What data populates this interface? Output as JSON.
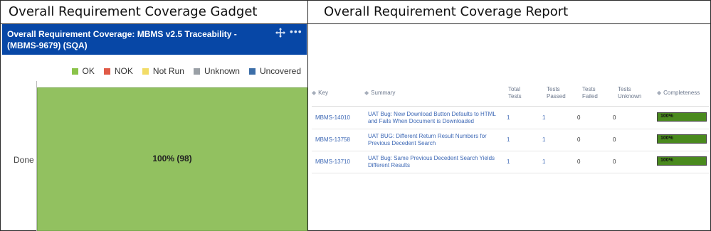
{
  "panels": {
    "left_title": "Overall Requirement Coverage Gadget",
    "right_title": "Overall Requirement Coverage Report"
  },
  "gadget": {
    "title": "Overall Requirement Coverage: MBMS v2.5 Traceability - (MBMS-9679) (SQA)",
    "header_color": "#0747a6",
    "icons": [
      "move-icon",
      "more-icon"
    ],
    "more_glyph": "•••",
    "legend": [
      {
        "label": "OK",
        "color": "#8bc34a"
      },
      {
        "label": "NOK",
        "color": "#e05a47"
      },
      {
        "label": "Not Run",
        "color": "#f2dc67"
      },
      {
        "label": "Unknown",
        "color": "#9aa0a6"
      },
      {
        "label": "Uncovered",
        "color": "#3c6ea8"
      }
    ]
  },
  "chart_data": {
    "type": "bar",
    "orientation": "horizontal",
    "stacked": true,
    "categories": [
      "Done"
    ],
    "series": [
      {
        "name": "OK",
        "values": [
          100
        ],
        "label": "100% (98)",
        "color": "#92c160"
      }
    ],
    "xlim": [
      0,
      100
    ]
  },
  "report": {
    "sort_glyph": "◆",
    "columns": [
      "Key",
      "Summary",
      "Total Tests",
      "Tests Passed",
      "Tests Failed",
      "Tests Unknown",
      "Completeness"
    ],
    "rows": [
      {
        "key": "MBMS-14010",
        "summary": "UAT Bug: New Download Button Defaults to HTML and Fails When Document is Downloaded",
        "total": "1",
        "passed": "1",
        "failed": "0",
        "unknown": "0",
        "completeness": 1.0,
        "completeness_text": "100%"
      },
      {
        "key": "MBMS-13758",
        "summary": "UAT BUG: Different Return Result Numbers for Previous Decedent Search",
        "total": "1",
        "passed": "1",
        "failed": "0",
        "unknown": "0",
        "completeness": 1.0,
        "completeness_text": "100%"
      },
      {
        "key": "MBMS-13710",
        "summary": "UAT Bug: Same Previous Decedent Search Yields Different Results",
        "total": "1",
        "passed": "1",
        "failed": "0",
        "unknown": "0",
        "completeness": 1.0,
        "completeness_text": "100%"
      }
    ]
  }
}
